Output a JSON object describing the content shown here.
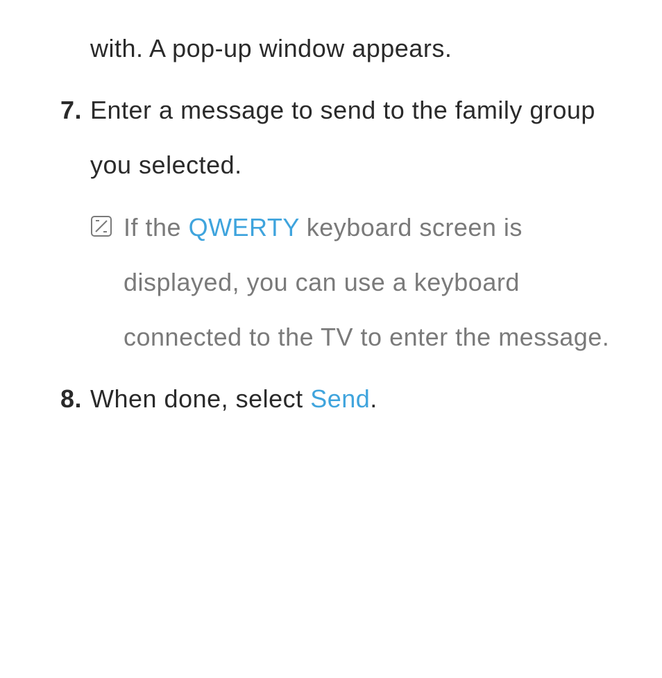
{
  "continuation": "with. A pop-up window appears.",
  "steps": [
    {
      "number": "7.",
      "text": "Enter a message to send to the family group you selected."
    },
    {
      "number": "8.",
      "prefix": "When done, select ",
      "highlight": "Send",
      "suffix": "."
    }
  ],
  "note": {
    "prefix": "If the ",
    "highlight": "QWERTY",
    "suffix": " keyboard screen is displayed, you can use a keyboard connected to the TV to enter the message."
  }
}
